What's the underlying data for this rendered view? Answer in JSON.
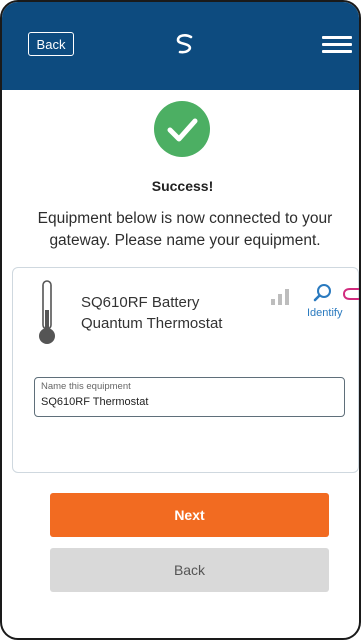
{
  "header": {
    "back_label": "Back",
    "logo_icon": "brand-swirl-icon",
    "menu_icon": "hamburger-menu-icon",
    "bg_color": "#0d4b7f"
  },
  "status": {
    "title": "Success!",
    "message": "Equipment below is now connected to your gateway. Please name your equipment.",
    "icon": "checkmark-circle-icon",
    "color": "#4caf63"
  },
  "device": {
    "name": "SQ610RF Battery Quantum Thermostat",
    "type_icon": "thermometer-icon",
    "signal_icon": "signal-strength-icon",
    "identify_label": "Identify"
  },
  "name_field": {
    "label": "Name this equipment",
    "value": "SQ610RF Thermostat"
  },
  "actions": {
    "next_label": "Next",
    "back_label": "Back",
    "accent": "#f26b21"
  }
}
